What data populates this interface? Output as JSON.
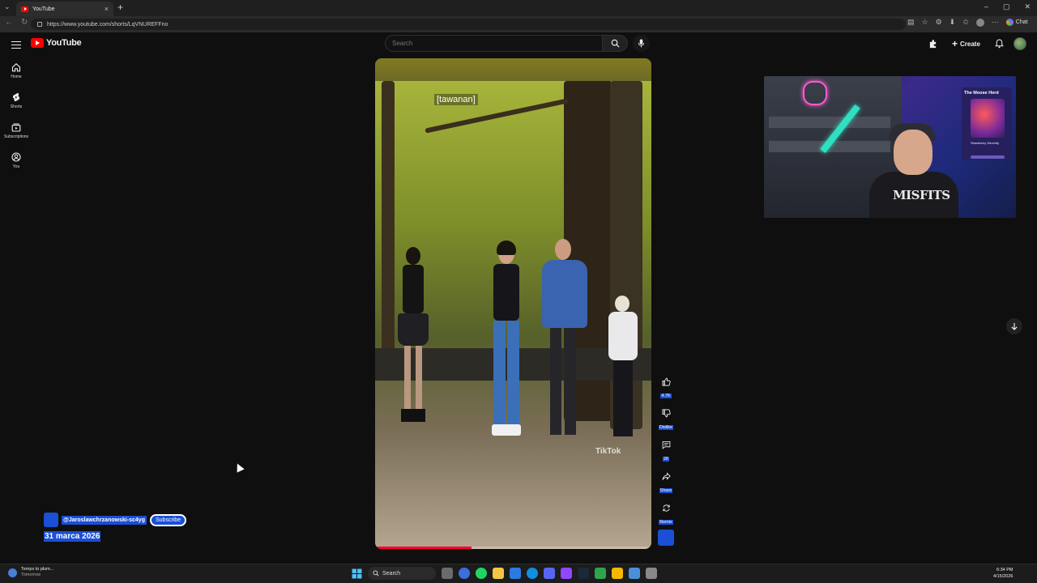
{
  "browser": {
    "tab_title": "YouTube",
    "tab_close": "×",
    "new_tab": "+",
    "url": "https://www.youtube.com/shorts/LqVNUREFFno",
    "chat_label": "Chat",
    "window_controls": [
      "–",
      "▢",
      "✕"
    ]
  },
  "header": {
    "logo_text": "YouTube",
    "search_placeholder": "Search",
    "create_label": "Create"
  },
  "sidebar": {
    "items": [
      {
        "label": "Home",
        "icon": "home-icon"
      },
      {
        "label": "Shorts",
        "icon": "shorts-icon"
      },
      {
        "label": "Subscriptions",
        "icon": "subscriptions-icon"
      },
      {
        "label": "You",
        "icon": "you-icon"
      }
    ]
  },
  "video": {
    "caption": "[tawanan]",
    "watermark": "TikTok",
    "progress_fraction": 0.35,
    "accent_color": "#ff0033"
  },
  "actions": {
    "likes": "4.7K",
    "dislike": "Dislike",
    "comments": "26",
    "share": "Share",
    "remix": "Remix"
  },
  "channel": {
    "handle": "@Jaroslawchrzanowski-sc4yg",
    "subscribe_label": "Subscribe",
    "date": "31 marca 2026",
    "highlight_color": "#1a4fd6"
  },
  "webcam": {
    "overlay_title": "The Moose Herd",
    "shirt_text": "MISFITS",
    "card_caption": "Strawberry Serenity"
  },
  "taskbar": {
    "weather_line1": "Temps to plum...",
    "weather_line2": "Tomorrow",
    "search_label": "Search",
    "time": "6:34 PM",
    "date": "4/15/2026"
  }
}
